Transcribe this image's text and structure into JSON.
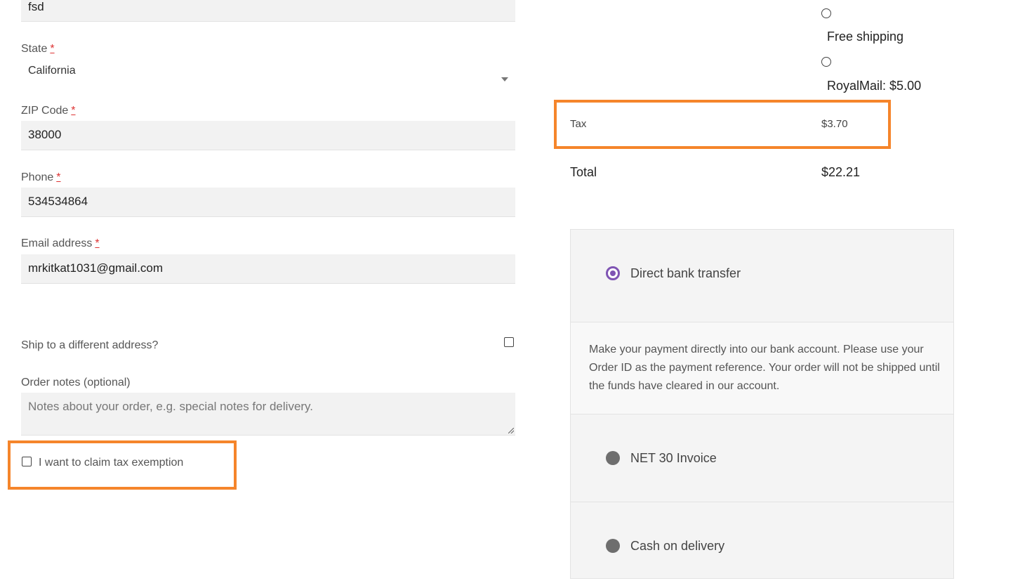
{
  "billing": {
    "prev_field_value": "fsd",
    "state": {
      "label": "State",
      "required_mark": "*",
      "value": "California"
    },
    "zip": {
      "label": "ZIP Code",
      "required_mark": "*",
      "value": "38000"
    },
    "phone": {
      "label": "Phone",
      "required_mark": "*",
      "value": "534534864"
    },
    "email": {
      "label": "Email address",
      "required_mark": "*",
      "value": "mrkitkat1031@gmail.com"
    },
    "ship_different": {
      "label": "Ship to a different address?",
      "checked": false
    },
    "order_notes": {
      "label": "Order notes (optional)",
      "placeholder": "Notes about your order, e.g. special notes for delivery."
    },
    "tax_exemption": {
      "label": "I want to claim tax exemption",
      "checked": false
    }
  },
  "summary": {
    "shipping_options": [
      {
        "label": "Free shipping"
      },
      {
        "label": "RoyalMail:",
        "price": "$5.00"
      }
    ],
    "tax": {
      "label": "Tax",
      "value": "$3.70"
    },
    "total": {
      "label": "Total",
      "value": "$22.21"
    }
  },
  "payment": {
    "methods": [
      {
        "label": "Direct bank transfer",
        "selected": true
      },
      {
        "label": "NET 30 Invoice",
        "selected": false
      },
      {
        "label": "Cash on delivery",
        "selected": false
      }
    ],
    "bank_description": "Make your payment directly into our bank account. Please use your Order ID as the payment reference. Your order will not be shipped until the funds have cleared in our account."
  },
  "colors": {
    "highlight": "#f5852b",
    "selected_radio": "#7f54b3",
    "unselected_radio": "#6e6e6e"
  }
}
